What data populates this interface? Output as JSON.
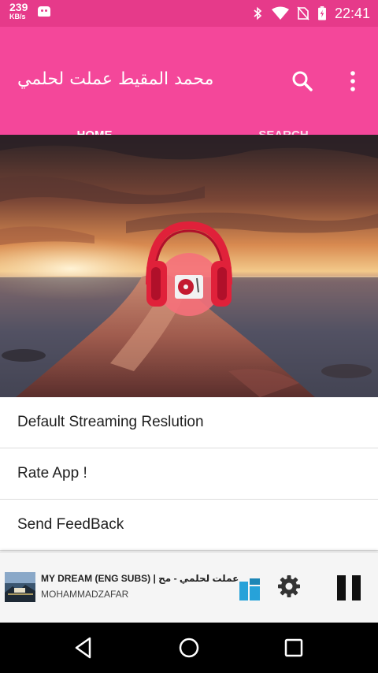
{
  "status_bar": {
    "net_speed_value": "239",
    "net_speed_unit": "KB/s",
    "time": "22:41",
    "icons": [
      "android-debug-icon",
      "bluetooth-icon",
      "wifi-icon",
      "no-sim-icon",
      "battery-charging-icon"
    ]
  },
  "app_bar": {
    "title": "محمد المقيط عملت لحلمي",
    "actions": [
      "search-icon",
      "more-vert-icon"
    ]
  },
  "tabs": [
    {
      "label": "HOME",
      "selected": true
    },
    {
      "label": "SEARCH",
      "selected": false
    }
  ],
  "hero": {
    "image": "sunset-sea-rock-with-headphones-vinyl-logo"
  },
  "menu": {
    "items": [
      {
        "label": "Default Streaming Reslution"
      },
      {
        "label": "Rate App !"
      },
      {
        "label": "Send FeedBack"
      }
    ]
  },
  "player": {
    "track_title": "MY DREAM (ENG SUBS) | عملت لحلمي - مح...",
    "artist": "MOHAMMADZAFAR",
    "controls": [
      "queue-icon",
      "settings-gear-icon",
      "pause-icon"
    ]
  },
  "nav_bar": {
    "buttons": [
      "back-icon",
      "home-icon",
      "recents-icon"
    ]
  },
  "colors": {
    "status_bar": "#e63a8a",
    "app_bar": "#f4479a",
    "accent_blue": "#27a2d9",
    "player_bg": "#f5f5f5"
  }
}
